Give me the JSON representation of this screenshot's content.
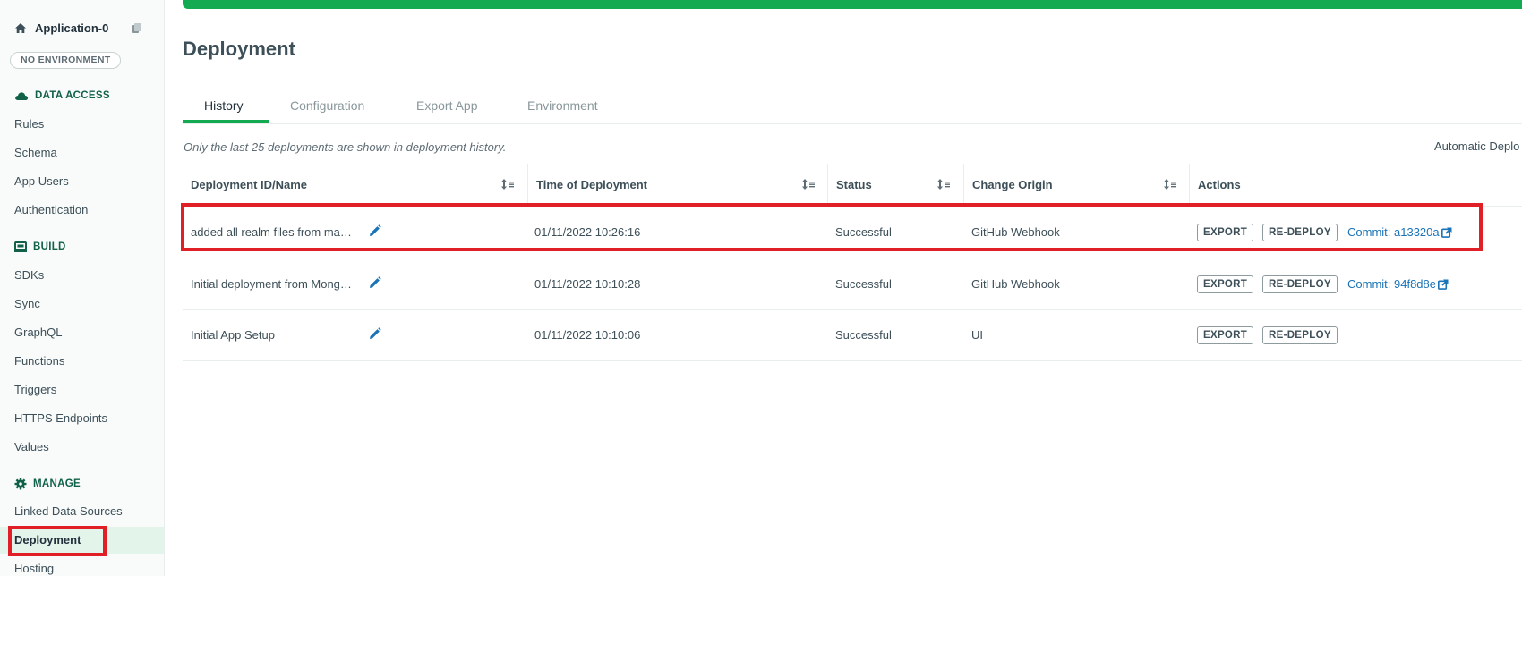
{
  "sidebar": {
    "app_name": "Application-0",
    "environment": "NO ENVIRONMENT",
    "sections": [
      {
        "title": "DATA ACCESS",
        "icon": "cloud-icon",
        "items": [
          "Rules",
          "Schema",
          "App Users",
          "Authentication"
        ]
      },
      {
        "title": "BUILD",
        "icon": "build-icon",
        "items": [
          "SDKs",
          "Sync",
          "GraphQL",
          "Functions",
          "Triggers",
          "HTTPS Endpoints",
          "Values"
        ]
      },
      {
        "title": "MANAGE",
        "icon": "gear-icon",
        "items": [
          "Linked Data Sources",
          "Deployment",
          "Hosting"
        ]
      }
    ],
    "active_item": "Deployment"
  },
  "page": {
    "title": "Deployment",
    "tabs": [
      "History",
      "Configuration",
      "Export App",
      "Environment"
    ],
    "active_tab": "History",
    "note": "Only the last 25 deployments are shown in deployment history.",
    "automatic_label": "Automatic Deplo"
  },
  "table": {
    "columns": [
      "Deployment ID/Name",
      "Time of Deployment",
      "Status",
      "Change Origin",
      "Actions"
    ],
    "rows": [
      {
        "name": "added all realm files from ma…",
        "time": "01/11/2022 10:26:16",
        "status": "Successful",
        "origin": "GitHub Webhook",
        "export": "EXPORT",
        "redeploy": "RE-DEPLOY",
        "commit": "Commit: a13320a"
      },
      {
        "name": "Initial deployment from Mong…",
        "time": "01/11/2022 10:10:28",
        "status": "Successful",
        "origin": "GitHub Webhook",
        "export": "EXPORT",
        "redeploy": "RE-DEPLOY",
        "commit": "Commit: 94f8d8e"
      },
      {
        "name": "Initial App Setup",
        "time": "01/11/2022 10:10:06",
        "status": "Successful",
        "origin": "UI",
        "export": "EXPORT",
        "redeploy": "RE-DEPLOY",
        "commit": ""
      }
    ]
  },
  "colors": {
    "accent": "#13aa52",
    "highlight": "#e01f26",
    "link": "#1a73b7",
    "section": "#116149"
  }
}
